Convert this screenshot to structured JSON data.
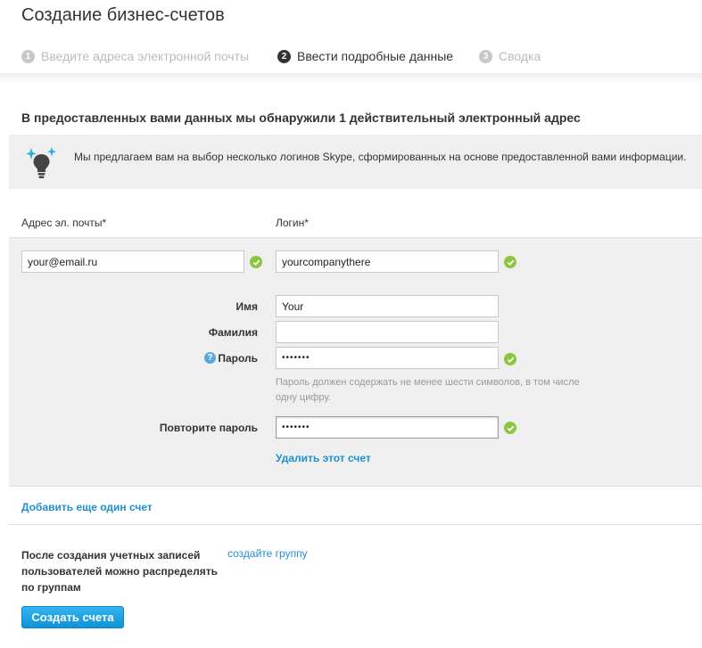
{
  "page": {
    "title": "Создание бизнес-счетов"
  },
  "steps": [
    {
      "number": "1",
      "label": "Введите адреса электронной почты",
      "state": "done"
    },
    {
      "number": "2",
      "label": "Ввести подробные данные",
      "state": "active"
    },
    {
      "number": "3",
      "label": "Сводка",
      "state": "pending"
    }
  ],
  "section": {
    "heading": "В предоставленных вами данных мы обнаружили 1 действительный электронный адрес"
  },
  "info": {
    "icon": "lightbulb-sparkle-icon",
    "text": "Мы предлагаем вам на выбор несколько логинов Skype, сформированных на основе предоставленной вами информации."
  },
  "form": {
    "email_label": "Адрес эл. почты*",
    "login_label": "Логин*",
    "email_value": "your@email.ru",
    "login_value": "yourcompanythere",
    "first_name_label": "Имя",
    "first_name_value": "Your",
    "last_name_label": "Фамилия",
    "last_name_value": "",
    "password_label": "Пароль",
    "password_value": "•••••••",
    "password_hint": "Пароль должен содержать не менее шести символов, в том числе одну цифру.",
    "repeat_password_label": "Повторите пароль",
    "repeat_password_value": "•••••••",
    "delete_account_link": "Удалить этот счет"
  },
  "add_account_link": "Добавить еще один счет",
  "groups": {
    "text": "После создания учетных записей пользователей можно распределять по группам",
    "link": "создайте группу"
  },
  "submit_button": "Создать счета",
  "colors": {
    "accent": "#1f8fd0",
    "valid": "#8cc63f",
    "panel": "#efefef",
    "button": "#1a9fe0"
  }
}
